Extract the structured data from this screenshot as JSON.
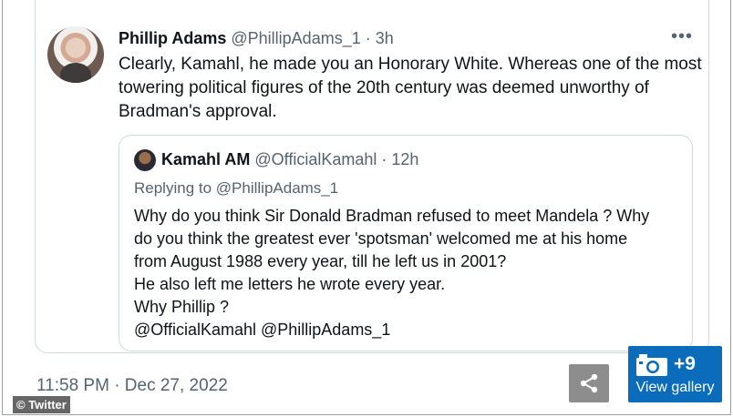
{
  "tweet": {
    "author_name": "Phillip Adams",
    "author_meta": "@PhillipAdams_1 · 3h",
    "more_icon": "more-dots-icon",
    "text": "Clearly, Kamahl, he made you an Honorary White. Whereas one of the most towering political figures of the 20th century was deemed unworthy of Bradman's approval.",
    "timestamp": "11:58 PM · Dec 27, 2022"
  },
  "quoted_tweet": {
    "author_name": "Kamahl AM",
    "author_meta": "@OfficialKamahl · 12h",
    "replying_prefix": "Replying to ",
    "replying_handle": "@PhillipAdams_1",
    "lines": [
      "Why do you think Sir Donald Bradman refused to meet Mandela ? Why",
      "do you think the greatest ever 'spotsman' welcomed me at his home",
      "from August 1988 every year, till he left us in 2001?",
      "He also left me letters he wrote every year.",
      "Why Phillip ?",
      "@OfficialKamahl @PhillipAdams_1"
    ]
  },
  "credit": "© Twitter",
  "gallery": {
    "count": "+9",
    "label": "View gallery",
    "icon": "camera-icon",
    "color": "#0a6cba"
  },
  "share": {
    "icon": "share-icon",
    "color": "#8d8d8d"
  }
}
